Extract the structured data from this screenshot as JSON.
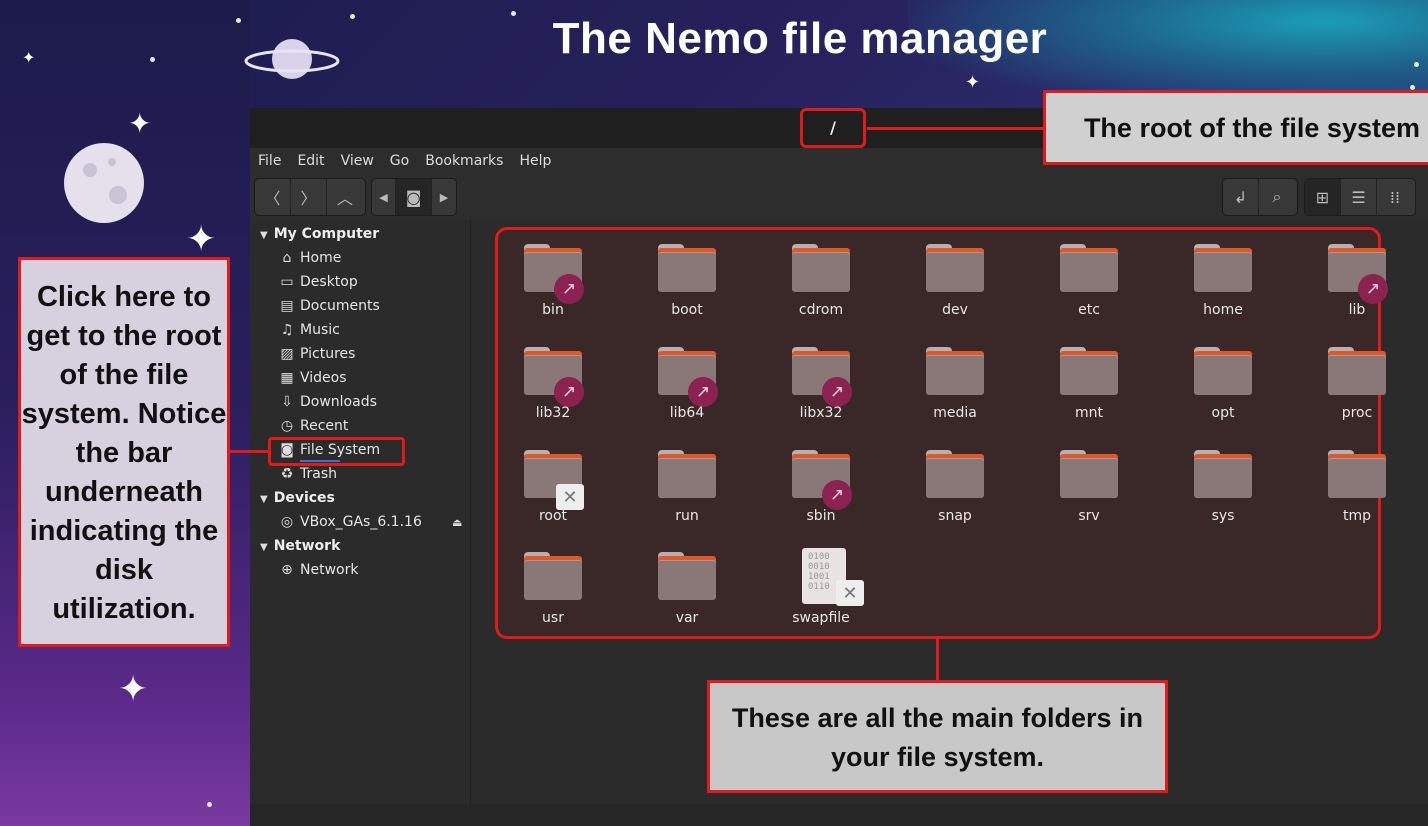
{
  "slide": {
    "title": "The Nemo file manager"
  },
  "window": {
    "path": "/",
    "menu": [
      "File",
      "Edit",
      "View",
      "Go",
      "Bookmarks",
      "Help"
    ]
  },
  "sidebar": {
    "sections": [
      {
        "title": "My Computer",
        "items": [
          {
            "label": "Home",
            "icon": "home-icon"
          },
          {
            "label": "Desktop",
            "icon": "desktop-icon"
          },
          {
            "label": "Documents",
            "icon": "documents-icon"
          },
          {
            "label": "Music",
            "icon": "music-icon"
          },
          {
            "label": "Pictures",
            "icon": "pictures-icon"
          },
          {
            "label": "Videos",
            "icon": "videos-icon"
          },
          {
            "label": "Downloads",
            "icon": "downloads-icon"
          },
          {
            "label": "Recent",
            "icon": "recent-icon"
          },
          {
            "label": "File System",
            "icon": "drive-icon"
          },
          {
            "label": "Trash",
            "icon": "trash-icon"
          }
        ]
      },
      {
        "title": "Devices",
        "items": [
          {
            "label": "VBox_GAs_6.1.16",
            "icon": "disc-icon"
          }
        ]
      },
      {
        "title": "Network",
        "items": [
          {
            "label": "Network",
            "icon": "network-icon"
          }
        ]
      }
    ]
  },
  "folders": [
    {
      "name": "bin",
      "badge": "link"
    },
    {
      "name": "boot",
      "badge": ""
    },
    {
      "name": "cdrom",
      "badge": ""
    },
    {
      "name": "dev",
      "badge": ""
    },
    {
      "name": "etc",
      "badge": ""
    },
    {
      "name": "home",
      "badge": ""
    },
    {
      "name": "lib",
      "badge": "link"
    },
    {
      "name": "lib32",
      "badge": "link"
    },
    {
      "name": "lib64",
      "badge": "link"
    },
    {
      "name": "libx32",
      "badge": "link"
    },
    {
      "name": "media",
      "badge": ""
    },
    {
      "name": "mnt",
      "badge": ""
    },
    {
      "name": "opt",
      "badge": ""
    },
    {
      "name": "proc",
      "badge": ""
    },
    {
      "name": "root",
      "badge": "locked"
    },
    {
      "name": "run",
      "badge": ""
    },
    {
      "name": "sbin",
      "badge": "link"
    },
    {
      "name": "snap",
      "badge": ""
    },
    {
      "name": "srv",
      "badge": ""
    },
    {
      "name": "sys",
      "badge": ""
    },
    {
      "name": "tmp",
      "badge": ""
    },
    {
      "name": "usr",
      "badge": ""
    },
    {
      "name": "var",
      "badge": ""
    },
    {
      "name": "swapfile",
      "badge": "locked",
      "type": "file",
      "file_text": "0100\n0010\n1001\n0110"
    }
  ],
  "callouts": {
    "left": "Click here to get to the root of the file system. Notice the bar underneath indicating the disk utilization.",
    "root": "The root of the file system",
    "main": "These are all the main folders in your file system."
  },
  "colors": {
    "highlight": "#e01b1b",
    "folder_accent": "#e0572a",
    "link_badge": "#8b2252"
  }
}
